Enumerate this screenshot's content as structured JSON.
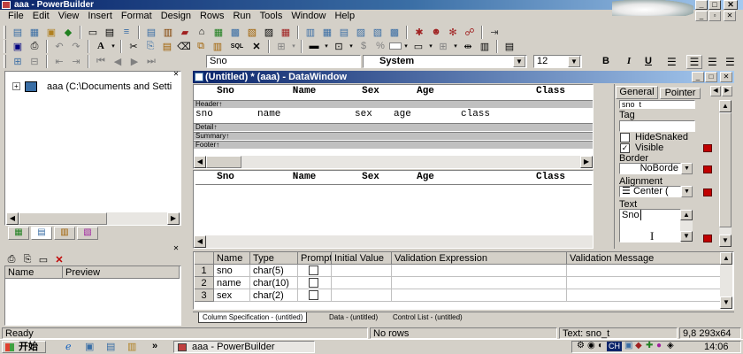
{
  "window": {
    "title": "aaa - PowerBuilder",
    "min_label": "_",
    "max_label": "□",
    "close_label": "✕"
  },
  "menubar": [
    "File",
    "Edit",
    "View",
    "Insert",
    "Format",
    "Design",
    "Rows",
    "Run",
    "Tools",
    "Window",
    "Help"
  ],
  "stylebar": {
    "field_value": "Sno",
    "font_value": "System",
    "size_value": "12",
    "bold": "B",
    "italic": "I",
    "underline": "U"
  },
  "toolbar2": {
    "sql_label": "SQL"
  },
  "left_panel": {
    "tree_item": "aaa (C:\\Documents and Setti"
  },
  "preview_panel": {
    "col_name": "Name",
    "col_preview": "Preview"
  },
  "datawindow": {
    "title": "(Untitled) * (aaa) - DataWindow",
    "header_cols": [
      "Sno",
      "Name",
      "Sex",
      "Age",
      "Class"
    ],
    "detail_cols": [
      "sno",
      "name",
      "sex",
      "age",
      "class"
    ],
    "bands": {
      "header": "Header↑",
      "detail": "Detail↑",
      "summary": "Summary↑",
      "footer": "Footer↑"
    }
  },
  "preview": {
    "header_cols": [
      "Sno",
      "Name",
      "Sex",
      "Age",
      "Class"
    ]
  },
  "properties": {
    "tabs": [
      "General",
      "Pointer"
    ],
    "name_value": "sno_t",
    "tag_label": "Tag",
    "hide_snaked": "HideSnaked",
    "hide_snaked_checked": false,
    "visible": "Visible",
    "visible_checked": true,
    "border_label": "Border",
    "border_value": "NoBorde",
    "alignment_label": "Alignment",
    "alignment_value": "Center (",
    "text_label": "Text",
    "text_value": "Sno"
  },
  "column_spec": {
    "headers": [
      "",
      "Name",
      "Type",
      "Prompt",
      "Initial Value",
      "Validation Expression",
      "Validation Message"
    ],
    "rows": [
      {
        "num": "1",
        "name": "sno",
        "type": "char(5)"
      },
      {
        "num": "2",
        "name": "name",
        "type": "char(10)"
      },
      {
        "num": "3",
        "name": "sex",
        "type": "char(2)"
      }
    ]
  },
  "bottom_tabs": [
    "Column Specification - (untitled)",
    "Data - (untitled)",
    "Control List - (untitled)"
  ],
  "status": {
    "ready": "Ready",
    "rows": "No rows",
    "text": "Text: sno_t",
    "coords": "9,8 293x64"
  },
  "taskbar": {
    "start": "开始",
    "chevron": "»",
    "app": "aaa - PowerBuilder",
    "lang": "CH",
    "time": "14:06"
  }
}
